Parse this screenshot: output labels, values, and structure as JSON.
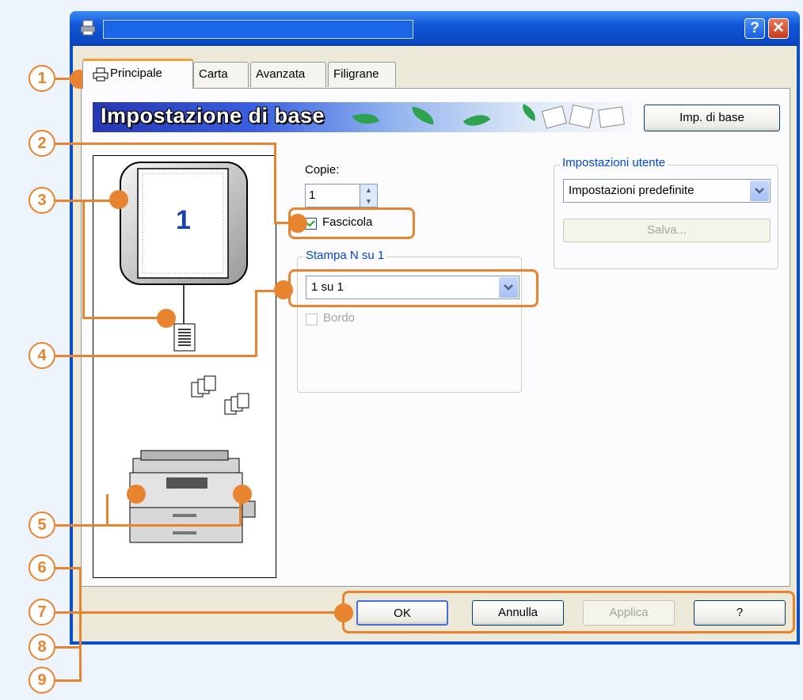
{
  "window": {
    "title": "",
    "help_caption": "?",
    "close_caption": "✕"
  },
  "tabs": [
    {
      "label": "Principale"
    },
    {
      "label": "Carta"
    },
    {
      "label": "Avanzata"
    },
    {
      "label": "Filigrane"
    }
  ],
  "banner": {
    "title": "Impostazione di base",
    "button_label": "Imp. di base"
  },
  "preview": {
    "page_number": "1"
  },
  "copies": {
    "label": "Copie:",
    "value": "1",
    "collate_label": "Fascicola",
    "collate_checked": true
  },
  "n_up": {
    "group_label": "Stampa N su 1",
    "selected": "1 su 1",
    "border_label": "Bordo",
    "border_checked": false
  },
  "user_settings": {
    "group_label": "Impostazioni utente",
    "selected": "Impostazioni predefinite",
    "save_label": "Salva..."
  },
  "buttons": {
    "ok": "OK",
    "cancel": "Annulla",
    "apply": "Applica",
    "help": "?"
  },
  "callouts": [
    "1",
    "2",
    "3",
    "4",
    "5",
    "6",
    "7",
    "8",
    "9"
  ],
  "colors": {
    "accent": "#e8832f",
    "titlebar": "#0a4fc9",
    "group_title": "#0046d5"
  }
}
